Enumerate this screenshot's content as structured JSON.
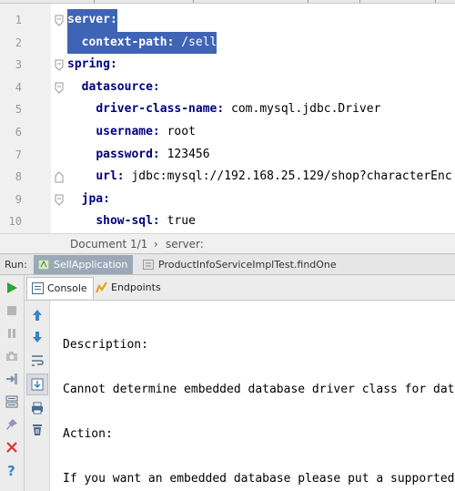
{
  "editor": {
    "lines": [
      {
        "num": "1",
        "key": "server:",
        "val": "",
        "indent": 0,
        "selected": true
      },
      {
        "num": "2",
        "key": "context-path:",
        "val": " /sell",
        "indent": 1,
        "selected": true
      },
      {
        "num": "3",
        "key": "spring:",
        "val": "",
        "indent": 0,
        "selected": false
      },
      {
        "num": "4",
        "key": "datasource:",
        "val": "",
        "indent": 1,
        "selected": false
      },
      {
        "num": "5",
        "key": "driver-class-name:",
        "val": " com.mysql.jdbc.Driver",
        "indent": 2,
        "selected": false
      },
      {
        "num": "6",
        "key": "username:",
        "val": " root",
        "indent": 2,
        "selected": false
      },
      {
        "num": "7",
        "key": "password:",
        "val": " 123456",
        "indent": 2,
        "selected": false
      },
      {
        "num": "8",
        "key": "url:",
        "val": " jdbc:mysql://192.168.25.129/shop?characterEnc",
        "indent": 2,
        "selected": false
      },
      {
        "num": "9",
        "key": "jpa:",
        "val": "",
        "indent": 1,
        "selected": false
      },
      {
        "num": "10",
        "key": "show-sql:",
        "val": " true",
        "indent": 2,
        "selected": false
      }
    ]
  },
  "breadcrumb": {
    "document": "Document 1/1",
    "separator": "›",
    "node": "server:"
  },
  "run_panel": {
    "label": "Run:",
    "tabs": [
      {
        "label": "SellApplication",
        "active": true
      },
      {
        "label": "ProductInfoServiceImplTest.findOne",
        "active": false
      }
    ],
    "subtabs": [
      {
        "label": "Console",
        "active": true
      },
      {
        "label": "Endpoints",
        "active": false
      }
    ]
  },
  "console": {
    "lines": [
      "Description:",
      "Cannot determine embedded database driver class for dat",
      "Action:",
      "If you want an embedded database please put a supported"
    ]
  },
  "icons": {
    "run": "run-icon",
    "stop": "stop-icon",
    "pause": "pause-icon",
    "camera": "camera-icon",
    "login": "import-icon",
    "layout": "layout-icon",
    "pin": "pin-icon",
    "close": "close-icon",
    "help": "help-icon",
    "up": "arrow-up-icon",
    "down": "arrow-down-icon",
    "wrap": "soft-wrap-icon",
    "scroll": "scroll-to-end-icon",
    "print": "print-icon",
    "trash": "trash-icon"
  },
  "colors": {
    "selection": "#3f64b6",
    "keyword": "#000080",
    "current_line": "#fffae3",
    "active_run_tab": "#9aa8b8",
    "run_green": "#2aa531",
    "close_red": "#d9352e",
    "arrow_blue": "#3b82c4"
  }
}
